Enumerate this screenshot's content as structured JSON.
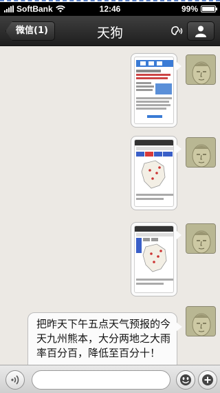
{
  "status": {
    "carrier": "SoftBank",
    "time": "12:46",
    "battery": "99%",
    "battery_level": 0.99
  },
  "nav": {
    "back_label": "微信(1)",
    "title": "天狗"
  },
  "messages": [
    {
      "type": "image",
      "from": "me"
    },
    {
      "type": "image",
      "from": "me"
    },
    {
      "type": "image",
      "from": "me"
    },
    {
      "type": "text",
      "from": "me",
      "text": "把昨天下午五点天气预报的今天九州熊本，大分两地之大雨率百分百，降低至百分十！"
    }
  ],
  "input": {
    "value": "",
    "placeholder": ""
  },
  "icons": {
    "ear": "ear-speaker-icon",
    "profile": "person-icon",
    "voice": "voice-icon",
    "emoji": "smiley-icon",
    "add": "plus-icon"
  }
}
